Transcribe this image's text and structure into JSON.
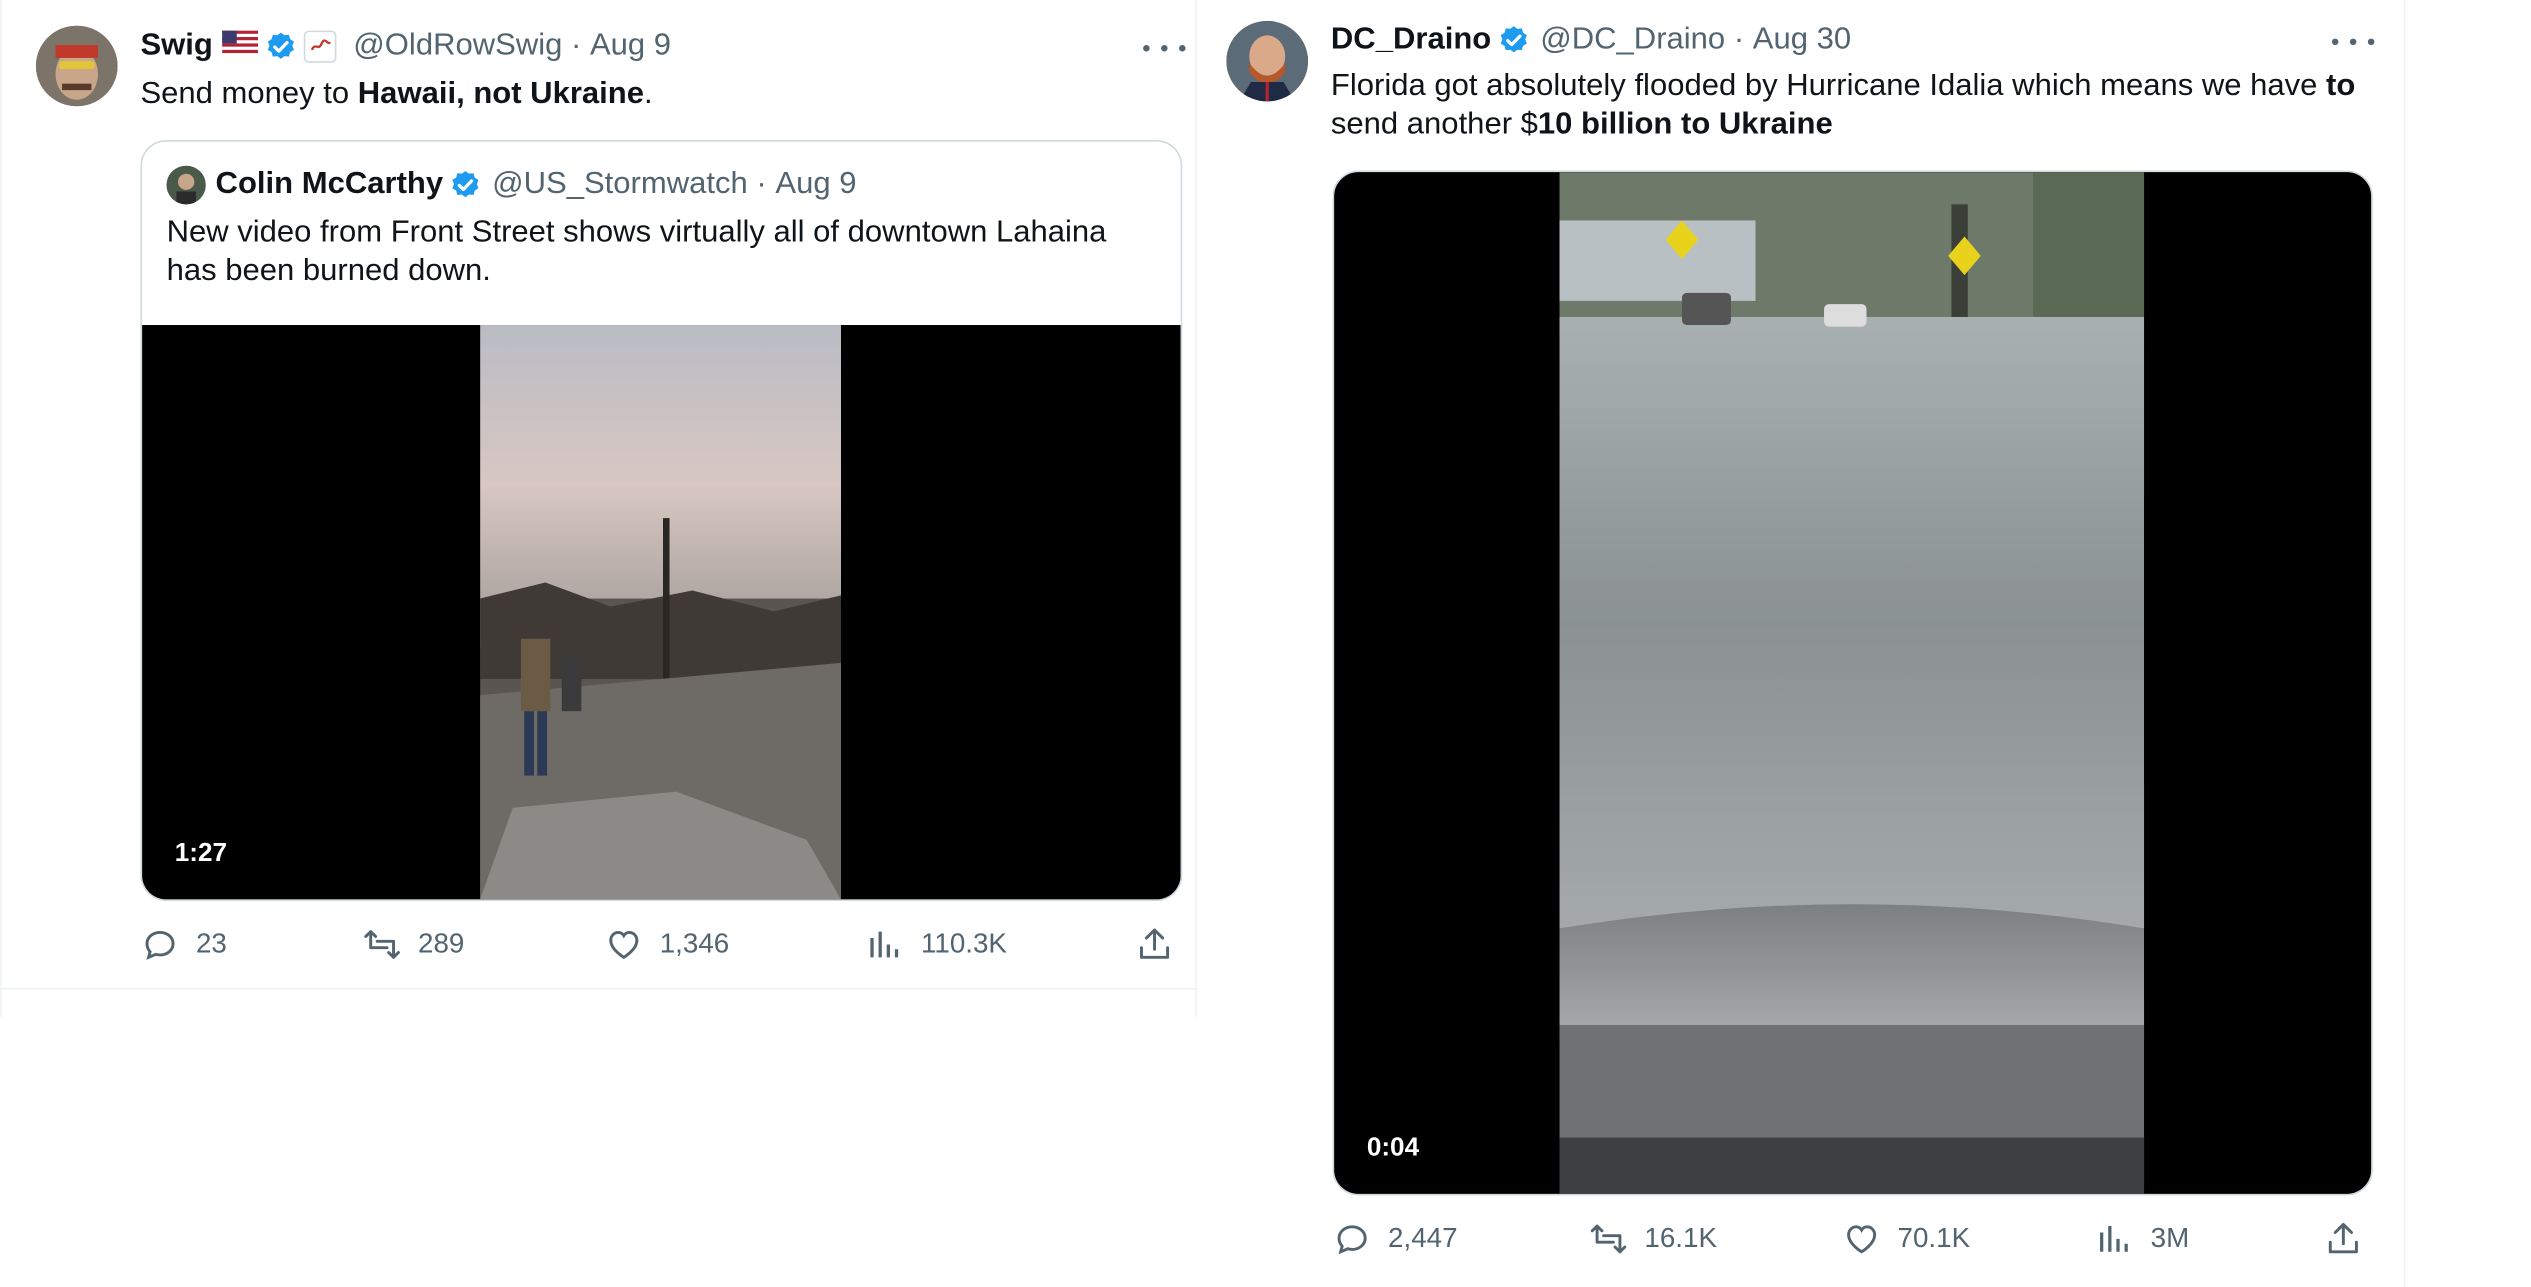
{
  "tweets": [
    {
      "display_name": "Swig",
      "handle": "@OldRowSwig",
      "date": "Aug 9",
      "text_parts": [
        "Send money to ",
        "Hawaii, not Ukraine",
        "."
      ],
      "quote": {
        "display_name": "Colin McCarthy",
        "handle": "@US_Stormwatch",
        "date": "Aug 9",
        "text": "New video from Front Street shows virtually all of downtown Lahaina has been burned down.",
        "video_duration": "1:27"
      },
      "stats": {
        "replies": "23",
        "reposts": "289",
        "likes": "1,346",
        "views": "110.3K"
      }
    },
    {
      "display_name": "DC_Draino",
      "handle": "@DC_Draino",
      "date": "Aug 30",
      "text_parts": [
        "Florida got absolutely flooded by Hurricane Idalia which means we have ",
        "to",
        " send another $",
        "10 billion to Ukraine"
      ],
      "video_duration": "0:04",
      "stats": {
        "replies": "2,447",
        "reposts": "16.1K",
        "likes": "70.1K",
        "views": "3M"
      }
    }
  ],
  "separator": " · ",
  "colors": {
    "verified": "#1d9bf0",
    "muted": "#536471",
    "text": "#0f1419",
    "border": "#cfd9de"
  }
}
